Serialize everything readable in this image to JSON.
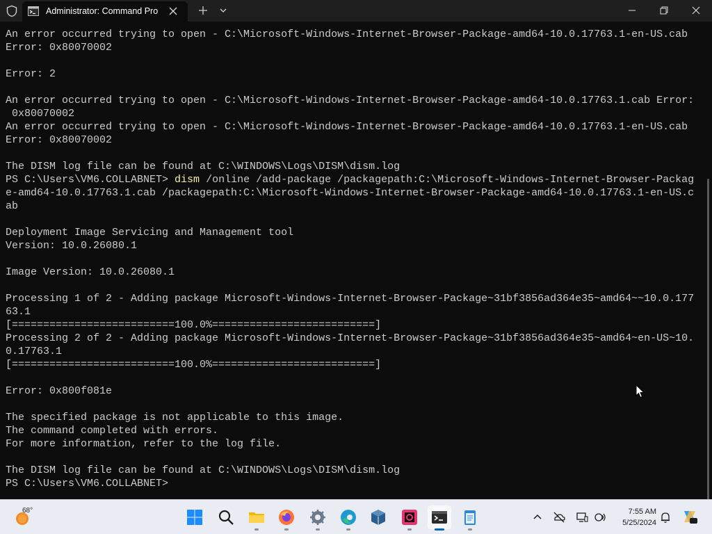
{
  "window": {
    "tab_title": "Administrator: Command Pro",
    "tab_icon": "terminal-icon"
  },
  "terminal": {
    "lines": [
      {
        "text": "An error occurred trying to open - C:\\Microsoft-Windows-Internet-Browser-Package-amd64-10.0.17763.1-en-US.cab"
      },
      {
        "text": "Error: 0x80070002"
      },
      {
        "text": ""
      },
      {
        "text": "Error: 2"
      },
      {
        "text": ""
      },
      {
        "text": "An error occurred trying to open - C:\\Microsoft-Windows-Internet-Browser-Package-amd64-10.0.17763.1.cab Error:"
      },
      {
        "text": " 0x80070002"
      },
      {
        "text": "An error occurred trying to open - C:\\Microsoft-Windows-Internet-Browser-Package-amd64-10.0.17763.1-en-US.cab"
      },
      {
        "text": "Error: 0x80070002"
      },
      {
        "text": ""
      },
      {
        "text": "The DISM log file can be found at C:\\WINDOWS\\Logs\\DISM\\dism.log"
      },
      {
        "prompt": "PS C:\\Users\\VM6.COLLABNET> ",
        "cmd": "dism",
        "text": " /online /add-package /packagepath:C:\\Microsoft-Windows-Internet-Browser-Packag"
      },
      {
        "text": "e-amd64-10.0.17763.1.cab /packagepath:C:\\Microsoft-Windows-Internet-Browser-Package-amd64-10.0.17763.1-en-US.c"
      },
      {
        "text": "ab"
      },
      {
        "text": ""
      },
      {
        "text": "Deployment Image Servicing and Management tool"
      },
      {
        "text": "Version: 10.0.26080.1"
      },
      {
        "text": ""
      },
      {
        "text": "Image Version: 10.0.26080.1"
      },
      {
        "text": ""
      },
      {
        "text": "Processing 1 of 2 - Adding package Microsoft-Windows-Internet-Browser-Package~31bf3856ad364e35~amd64~~10.0.177"
      },
      {
        "text": "63.1"
      },
      {
        "text": "[==========================100.0%==========================]"
      },
      {
        "text": "Processing 2 of 2 - Adding package Microsoft-Windows-Internet-Browser-Package~31bf3856ad364e35~amd64~en-US~10."
      },
      {
        "text": "0.17763.1"
      },
      {
        "text": "[==========================100.0%==========================]"
      },
      {
        "text": ""
      },
      {
        "text": "Error: 0x800f081e"
      },
      {
        "text": ""
      },
      {
        "text": "The specified package is not applicable to this image."
      },
      {
        "text": "The command completed with errors."
      },
      {
        "text": "For more information, refer to the log file."
      },
      {
        "text": ""
      },
      {
        "text": "The DISM log file can be found at C:\\WINDOWS\\Logs\\DISM\\dism.log"
      },
      {
        "text": "PS C:\\Users\\VM6.COLLABNET>"
      }
    ]
  },
  "taskbar": {
    "weather_temp": "68°",
    "apps": [
      "windows-start-icon",
      "search-icon",
      "file-explorer-icon",
      "firefox-icon",
      "settings-icon",
      "edge-icon",
      "virtualbox-icon",
      "jetbrains-icon",
      "terminal-icon",
      "notepad-icon"
    ],
    "tray": [
      "chevron-up-icon",
      "onedrive-icon",
      "display-icon",
      "network-volume-icon"
    ],
    "clock": {
      "time": "7:55 AM",
      "date": "5/25/2024"
    }
  },
  "colors": {
    "terminal_bg": "#0c0c0c",
    "terminal_text": "#cccccc",
    "command_highlight": "#f9f1a5",
    "titlebar_bg": "#1f1f1f",
    "taskbar_bg": "#e9edf3",
    "accent": "#0067c0"
  }
}
